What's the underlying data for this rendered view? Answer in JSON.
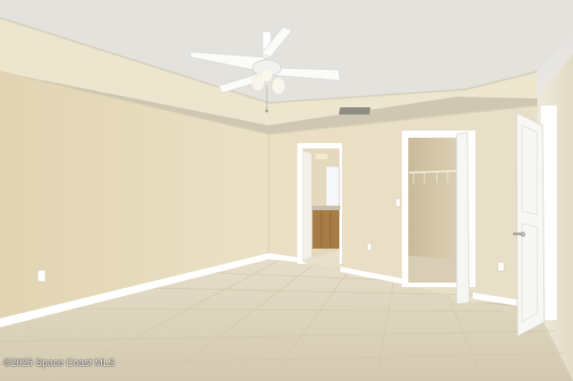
{
  "watermark": {
    "text": "©2025 Space Coast MLS"
  },
  "palette": {
    "ceiling": "#e6e5e0",
    "tray": "#ece7d4",
    "wall_left": "#e7dbbd",
    "wall_back": "#e9e0c6",
    "wall_right": "#ebe5d3",
    "floor": "#ddd3bd",
    "trim": "#ffffff",
    "door": "#f6f6f3",
    "closet_interior": "#d2c5a6",
    "cabinet": "#a87c46"
  }
}
